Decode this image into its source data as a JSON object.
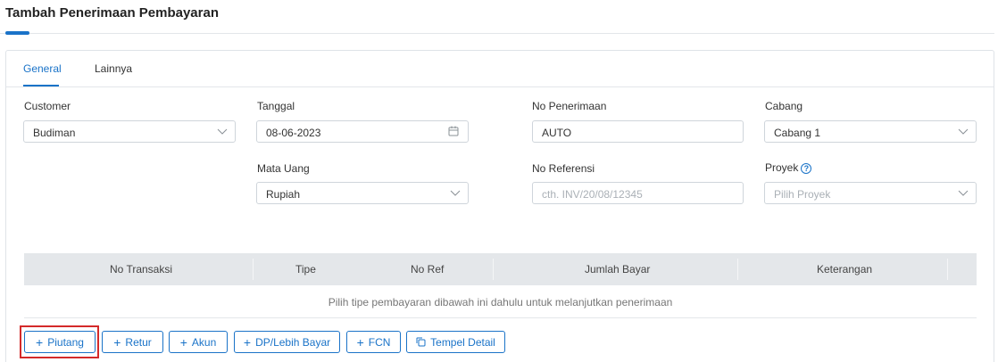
{
  "page": {
    "title": "Tambah Penerimaan Pembayaran"
  },
  "tabs": [
    "General",
    "Lainnya"
  ],
  "form": {
    "customer": {
      "label": "Customer",
      "value": "Budiman"
    },
    "tanggal": {
      "label": "Tanggal",
      "value": "08-06-2023"
    },
    "no_penerimaan": {
      "label": "No Penerimaan",
      "value": "AUTO"
    },
    "cabang": {
      "label": "Cabang",
      "value": "Cabang 1"
    },
    "mata_uang": {
      "label": "Mata Uang",
      "value": "Rupiah"
    },
    "no_referensi": {
      "label": "No Referensi",
      "placeholder": "cth. INV/20/08/12345"
    },
    "proyek": {
      "label": "Proyek",
      "placeholder": "Pilih Proyek",
      "help": "?"
    }
  },
  "table": {
    "columns": [
      "No Transaksi",
      "Tipe",
      "No Ref",
      "Jumlah Bayar",
      "Keterangan"
    ],
    "empty_message": "Pilih tipe pembayaran dibawah ini dahulu untuk melanjutkan penerimaan"
  },
  "actions": {
    "piutang": "Piutang",
    "retur": "Retur",
    "akun": "Akun",
    "dp": "DP/Lebih Bayar",
    "fcn": "FCN",
    "tempel": "Tempel Detail"
  },
  "colors": {
    "accent": "#1a73c8",
    "highlight": "#d42a2a",
    "table_header": "#e4e7ea"
  }
}
